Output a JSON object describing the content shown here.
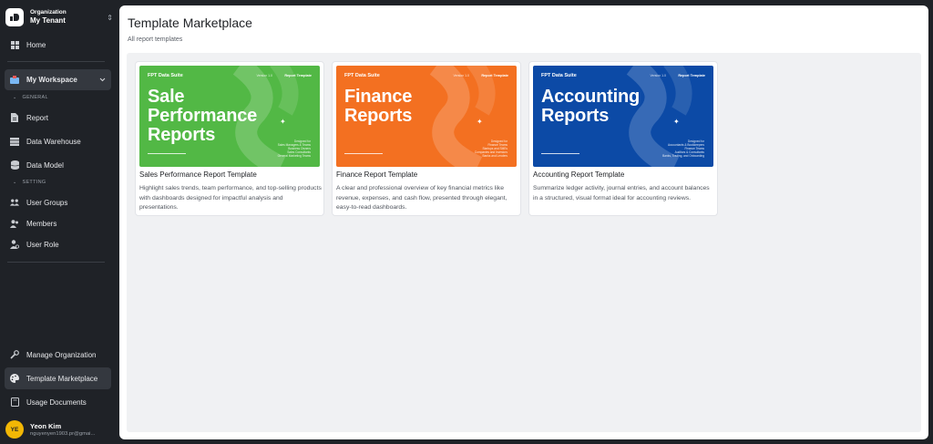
{
  "org": {
    "label": "Organization",
    "name": "My Tenant"
  },
  "nav": {
    "home": "Home",
    "workspace": "My Workspace",
    "general": "GENERAL",
    "report": "Report",
    "data_warehouse": "Data Warehouse",
    "data_model": "Data Model",
    "setting": "SETTING",
    "user_groups": "User Groups",
    "members": "Members",
    "user_role": "User Role",
    "manage_org": "Manage Organization",
    "template_marketplace": "Template Marketplace",
    "usage_docs": "Usage Documents"
  },
  "user": {
    "initials": "YE",
    "name": "Yeon Kim",
    "email": "nguyenyen1903.pr@gmai..."
  },
  "page": {
    "title": "Template Marketplace",
    "subtitle": "All report templates"
  },
  "cards": [
    {
      "brand": "FPT Data Suite",
      "version": "Version 1.0",
      "tag": "Report Template",
      "big": "Sale Performance Reports",
      "big_lines": [
        "Sale",
        "Performance",
        "Reports"
      ],
      "bullets": [
        "Designed for",
        "Sales Managers & Teams",
        "Business Owners",
        "Sales Consultants",
        "General Marketing Teams"
      ],
      "color": "#52b845",
      "title": "Sales Performance Report Template",
      "desc": "Highlight sales trends, team performance, and top-selling products with dashboards designed for impactful analysis and presentations."
    },
    {
      "brand": "FPT Data Suite",
      "version": "Version 1.0",
      "tag": "Report Template",
      "big": "Finance Reports",
      "big_lines": [
        "Finance",
        "Reports"
      ],
      "bullets": [
        "Designed for",
        "Finance Teams",
        "Startups and SMEs",
        "Companies and Investors",
        "Banks and Lenders"
      ],
      "color": "#f37021",
      "title": "Finance Report Template",
      "desc": "A clear and professional overview of key financial metrics like revenue, expenses, and cash flow, presented through elegant, easy-to-read dashboards."
    },
    {
      "brand": "FPT Data Suite",
      "version": "Version 1.0",
      "tag": "Report Template",
      "big": "Accounting Reports",
      "big_lines": [
        "Accounting",
        "Reports"
      ],
      "bullets": [
        "Designed for",
        "Accountants & Bookkeepers",
        "Finance Teams",
        "Auditors & Consultants",
        "Banks, Trading, and Onboarding"
      ],
      "color": "#0c4aa6",
      "title": "Accounting Report Template",
      "desc": "Summarize ledger activity, journal entries, and account balances in a structured, visual format ideal for accounting reviews."
    }
  ],
  "colors": {
    "sidebar_bg": "#1f2227",
    "active_bg": "#34383f",
    "avatar": "#f2b705"
  }
}
